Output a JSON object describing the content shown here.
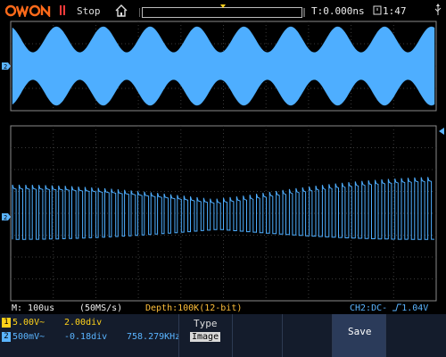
{
  "brand": {
    "logo_text": "owon"
  },
  "top_bar": {
    "run_state": "Stop",
    "trigger_time": "T:0.000ns",
    "clock": "1:47"
  },
  "colors": {
    "ch1": "#ffd21a",
    "ch2": "#5ab4ff",
    "wave_top": "#63b8ff",
    "wave_bottom": "#63b8ff",
    "grid": "#3a3a3a",
    "status_depth": "#ffbf3a",
    "menu_bg": "#141c2c"
  },
  "icons": {
    "pause": "pause-icon",
    "home": "home-icon",
    "usb": "usb-icon",
    "trigger_level": "trigger-level-arrow-icon",
    "channel_marker": "channel-2-marker-icon",
    "rising_edge": "rising-edge-icon"
  },
  "status": {
    "timebase": "M: 100us",
    "sample_rate": "(50MS/s)",
    "depth": "Depth:100K(12-bit)",
    "trigger": "CH2:DC-",
    "trigger_level": "1.04V"
  },
  "channels": [
    {
      "badge": "1",
      "volts": "5.00V~",
      "position": "2.00div",
      "freq": ""
    },
    {
      "badge": "2",
      "volts": "500mV~",
      "position": "-0.18div",
      "freq": "758.279KHz"
    }
  ],
  "menu": {
    "type_label": "Type",
    "type_value": "Image",
    "save_label": "Save"
  },
  "waveforms": {
    "top_trace": {
      "description": "amplitude-modulated carrier",
      "cycles": 9
    },
    "bottom_trace": {
      "description": "square wave with slowly varying duty cycle",
      "pulses": 64
    }
  }
}
